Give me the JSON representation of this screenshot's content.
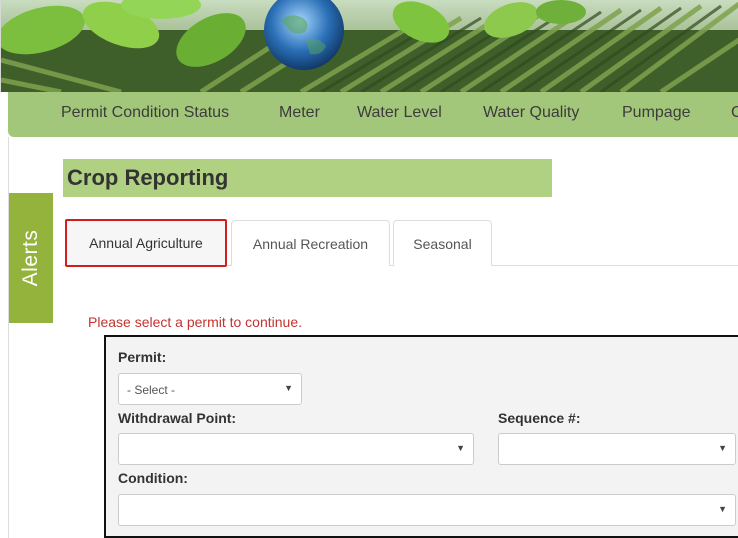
{
  "nav": {
    "items": [
      "Permit Condition Status",
      "Meter",
      "Water Level",
      "Water Quality",
      "Pumpage",
      "C"
    ]
  },
  "sidebar": {
    "alerts_label": "Alerts"
  },
  "page": {
    "title": "Crop Reporting"
  },
  "tabs": [
    {
      "label": "Annual Agriculture",
      "active": true
    },
    {
      "label": "Annual Recreation",
      "active": false
    },
    {
      "label": "Seasonal",
      "active": false
    }
  ],
  "message": "Please select a permit to continue.",
  "form": {
    "permit_label": "Permit:",
    "permit_value": "- Select -",
    "withdrawal_label": "Withdrawal Point:",
    "withdrawal_value": "",
    "sequence_label": "Sequence #:",
    "sequence_value": "",
    "condition_label": "Condition:",
    "condition_value": ""
  },
  "colors": {
    "nav_bg": "#a3c77a",
    "title_bg": "#b1d182",
    "alerts_bg": "#93b33c",
    "message": "#c4332f",
    "active_tab_border": "#d01e1e"
  }
}
